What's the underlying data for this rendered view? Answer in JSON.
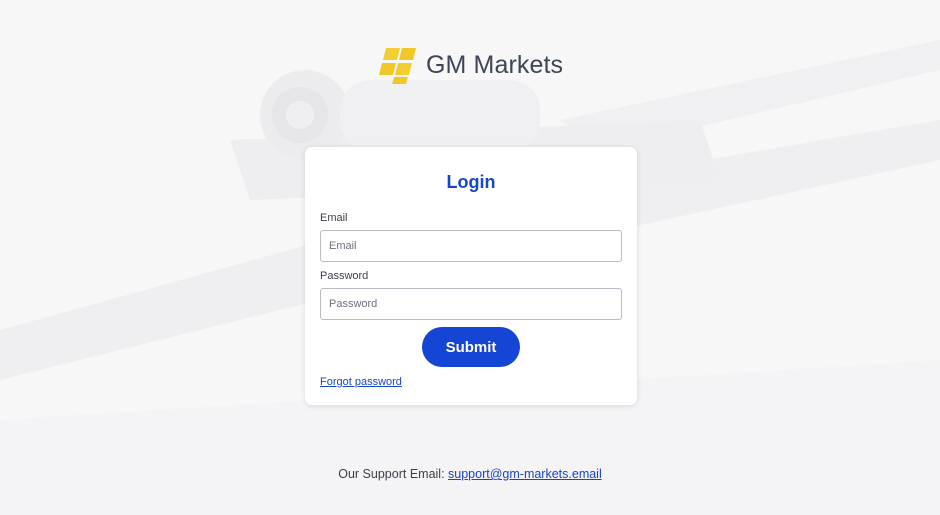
{
  "brand": {
    "name": "GM Markets",
    "logo_color": "#f1c82a"
  },
  "login": {
    "title": "Login",
    "email_label": "Email",
    "email_placeholder": "Email",
    "email_value": "",
    "password_label": "Password",
    "password_placeholder": "Password",
    "password_value": "",
    "submit_label": "Submit",
    "forgot_label": "Forgot password"
  },
  "footer": {
    "support_prefix": "Our Support Email:",
    "support_email": "support@gm-markets.email"
  },
  "colors": {
    "accent": "#1545d4",
    "link": "#1846c8",
    "background": "#f7f7f8"
  }
}
